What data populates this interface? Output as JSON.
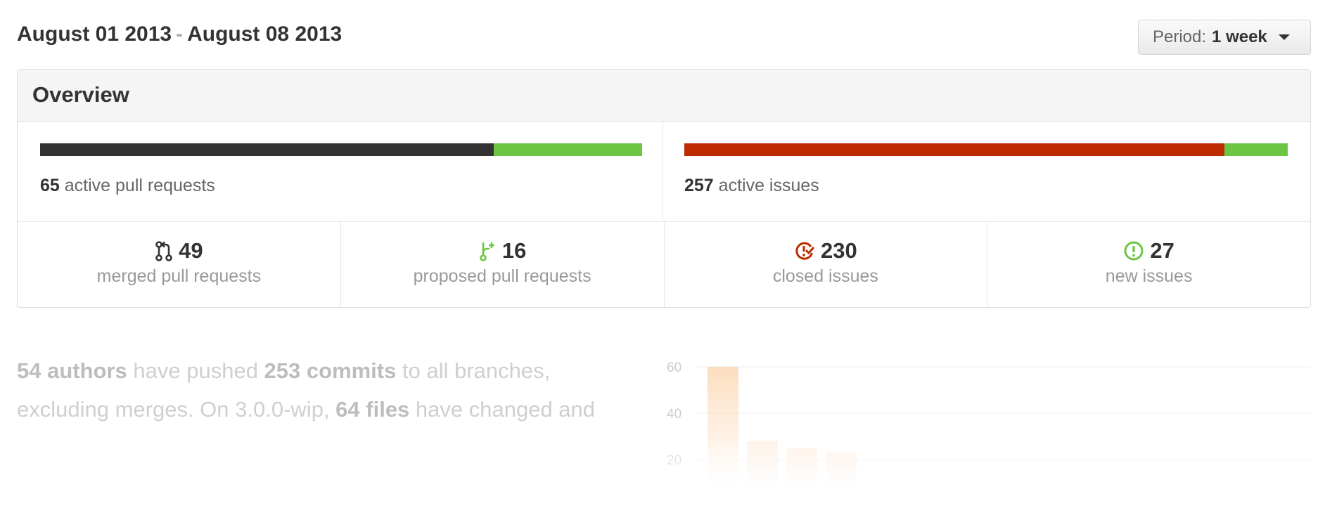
{
  "header": {
    "date_start": "August 01 2013",
    "separator": "-",
    "date_end": "August 08 2013",
    "period_label": "Period:",
    "period_value": "1 week"
  },
  "overview": {
    "title": "Overview",
    "pull_requests": {
      "count": "65",
      "label": "active pull requests",
      "merged_fraction": 0.754,
      "colors": {
        "merged": "#333333",
        "proposed": "#6cc644"
      }
    },
    "issues": {
      "count": "257",
      "label": "active issues",
      "closed_fraction": 0.895,
      "colors": {
        "closed": "#bd2c00",
        "new": "#6cc644"
      }
    },
    "stats": [
      {
        "icon": "git-merge-icon",
        "value": "49",
        "label": "merged pull requests",
        "color": "#333333"
      },
      {
        "icon": "git-pull-request-icon",
        "value": "16",
        "label": "proposed pull requests",
        "color": "#6cc644"
      },
      {
        "icon": "issue-closed-icon",
        "value": "230",
        "label": "closed issues",
        "color": "#bd2c00"
      },
      {
        "icon": "issue-opened-icon",
        "value": "27",
        "label": "new issues",
        "color": "#6cc644"
      }
    ]
  },
  "commits": {
    "authors": "54 authors",
    "t1": " have pushed ",
    "commits": "253 commits",
    "t2": " to all branches, excluding merges. On 3.0.0-wip, ",
    "files": "64 files",
    "t3": " have changed and"
  },
  "chart_data": {
    "type": "bar",
    "yticks": [
      "60",
      "40",
      "20"
    ],
    "ylim": [
      0,
      60
    ],
    "values": [
      60,
      28,
      25,
      23
    ],
    "color": "#f9c99a"
  }
}
